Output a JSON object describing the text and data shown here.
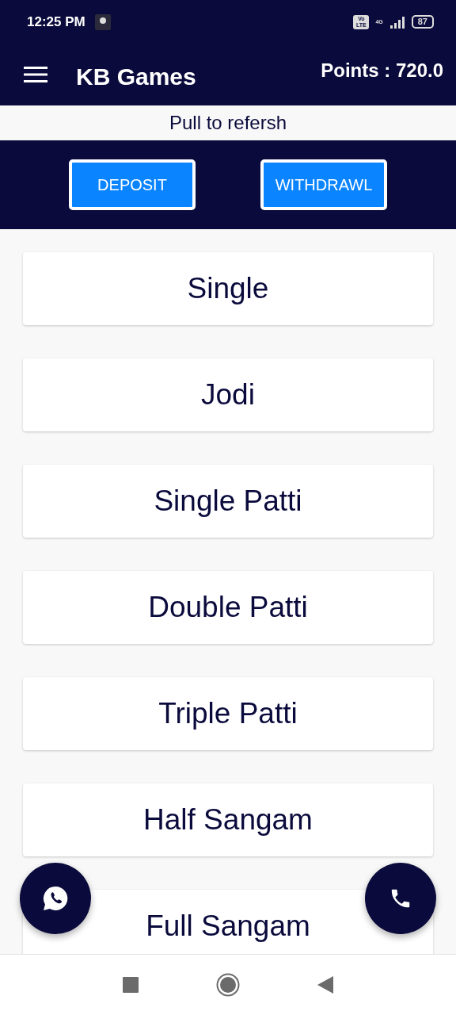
{
  "status_bar": {
    "time": "12:25 PM",
    "volte": "Vo LTE",
    "network": "4G",
    "battery": "87"
  },
  "app_bar": {
    "title": "KB Games",
    "points": "Points : 720.0"
  },
  "refresh_hint": "Pull to refersh",
  "actions": [
    "DEPOSIT",
    "WITHDRAWL"
  ],
  "games": [
    "Single",
    "Jodi",
    "Single Patti",
    "Double Patti",
    "Triple Patti",
    "Half Sangam",
    "Full Sangam"
  ]
}
